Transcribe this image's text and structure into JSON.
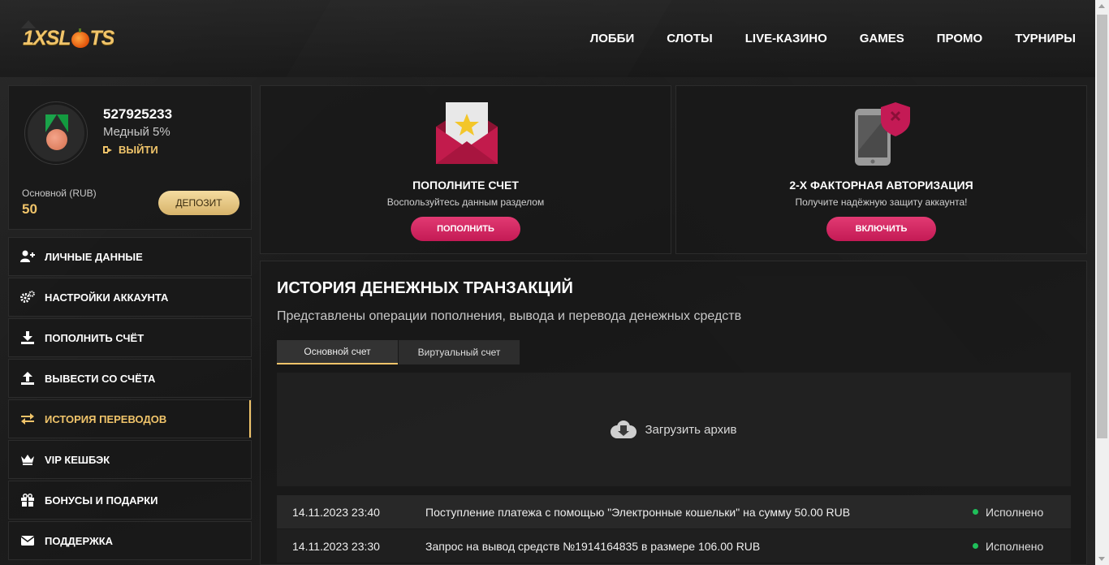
{
  "header": {
    "logo": {
      "part1": "1XSL",
      "part2": "TS"
    },
    "nav": [
      "ЛОББИ",
      "СЛОТЫ",
      "LIVE-КАЗИНО",
      "GAMES",
      "ПРОМО",
      "ТУРНИРЫ"
    ]
  },
  "profile": {
    "user_id": "527925233",
    "level": "Медный 5%",
    "logout_label": "ВЫЙТИ",
    "account_label": "Основной (RUB)",
    "balance": "50",
    "deposit_label": "ДЕПОЗИТ"
  },
  "menu": [
    {
      "label": "ЛИЧНЫЕ ДАННЫЕ",
      "icon": "user-plus-icon"
    },
    {
      "label": "НАСТРОЙКИ АККАУНТА",
      "icon": "gears-icon"
    },
    {
      "label": "ПОПОЛНИТЬ СЧЁТ",
      "icon": "download-icon"
    },
    {
      "label": "ВЫВЕСТИ СО СЧЁТА",
      "icon": "upload-icon"
    },
    {
      "label": "ИСТОРИЯ ПЕРЕВОДОВ",
      "icon": "exchange-icon",
      "active": true
    },
    {
      "label": "VIP КЕШБЭК",
      "icon": "crown-icon"
    },
    {
      "label": "БОНУСЫ И ПОДАРКИ",
      "icon": "gift-icon"
    },
    {
      "label": "ПОДДЕРЖКА",
      "icon": "envelope-icon"
    }
  ],
  "cards": [
    {
      "title": "ПОПОЛНИТЕ СЧЕТ",
      "subtitle": "Воспользуйтесь данным разделом",
      "button": "ПОПОЛНИТЬ",
      "icon": "envelope-star-icon"
    },
    {
      "title": "2-Х ФАКТОРНАЯ АВТОРИЗАЦИЯ",
      "subtitle": "Получите надёжную защиту аккаунта!",
      "button": "ВКЛЮЧИТЬ",
      "icon": "phone-shield-icon"
    }
  ],
  "history": {
    "title": "ИСТОРИЯ ДЕНЕЖНЫХ ТРАНЗАКЦИЙ",
    "subtitle": "Представлены операции пополнения, вывода и перевода денежных средств",
    "tabs": [
      {
        "label": "Основной счет",
        "active": true
      },
      {
        "label": "Виртуальный счет",
        "active": false
      }
    ],
    "archive_label": "Загрузить архив",
    "rows": [
      {
        "date": "14.11.2023 23:40",
        "description": "Поступление платежа с помощью \"Электронные кошельки\" на сумму 50.00 RUB",
        "status": "Исполнено"
      },
      {
        "date": "14.11.2023 23:30",
        "description": "Запрос на вывод средств №1914164835 в размере 106.00 RUB",
        "status": "Исполнено"
      }
    ]
  },
  "colors": {
    "accent_gold": "#f0c46a",
    "button_pink": "#d42a64",
    "status_green": "#1fbf5a"
  }
}
